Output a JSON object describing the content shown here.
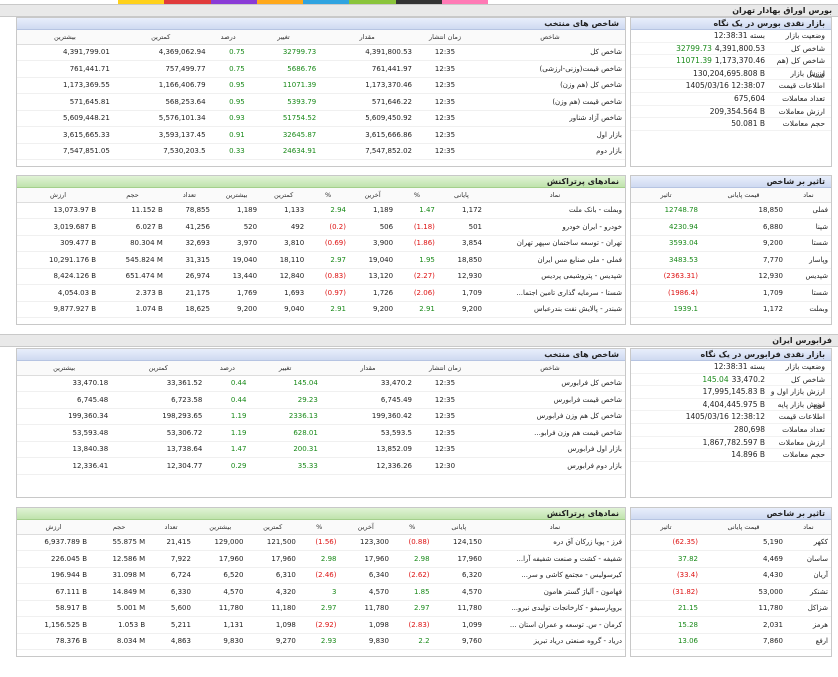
{
  "colorstrip": [
    "#ffd11a",
    "#e03b3b",
    "#8a3bd6",
    "#ffa81a",
    "#2fa3e0",
    "#8ac43b",
    "#333333",
    "#ff7ab5"
  ],
  "tehran": {
    "title": "بورس اوراق بهادار تهران",
    "overview": {
      "title": "بازار نقدی بورس در یک نگاه",
      "rows": [
        {
          "label": "وضعیت بازار",
          "value": "بسته 12:38:31",
          "change": ""
        },
        {
          "label": "شاخص کل",
          "value": "4,391,800.53",
          "change": "32799.73"
        },
        {
          "label": "شاخص کل (هم وزن)",
          "value": "1,173,370.46",
          "change": "11071.39"
        },
        {
          "label": "ارزش بازار",
          "value": "130,204,695.808 B",
          "change": ""
        },
        {
          "label": "اطلاعات قیمت",
          "value": "1405/03/16 12:38:07",
          "change": ""
        },
        {
          "label": "تعداد معاملات",
          "value": "675,604",
          "change": ""
        },
        {
          "label": "ارزش معاملات",
          "value": "209,354.564 B",
          "change": ""
        },
        {
          "label": "حجم معاملات",
          "value": "50.081 B",
          "change": ""
        }
      ]
    },
    "indices": {
      "title": "شاخص های منتخب",
      "headers": [
        "شاخص",
        "زمان انتشار",
        "مقدار",
        "تغییر",
        "درصد",
        "کمترین",
        "بیشترین"
      ],
      "rows": [
        [
          "شاخص کل",
          "12:35",
          "4,391,800.53",
          "32799.73",
          "0.75",
          "4,369,062.94",
          "4,391,799.01"
        ],
        [
          "شاخص قیمت(وزنی-ارزشی)",
          "12:35",
          "761,441.97",
          "5686.76",
          "0.75",
          "757,499.77",
          "761,441.71"
        ],
        [
          "شاخص کل (هم وزن)",
          "12:35",
          "1,173,370.46",
          "11071.39",
          "0.95",
          "1,166,406.79",
          "1,173,369.55"
        ],
        [
          "شاخص قیمت (هم وزن)",
          "12:35",
          "571,646.22",
          "5393.79",
          "0.95",
          "568,253.64",
          "571,645.81"
        ],
        [
          "شاخص آزاد شناور",
          "12:35",
          "5,609,450.92",
          "51754.52",
          "0.93",
          "5,576,101.34",
          "5,609,448.21"
        ],
        [
          "بازار اول",
          "12:35",
          "3,615,666.86",
          "32645.87",
          "0.91",
          "3,593,137.45",
          "3,615,665.33"
        ],
        [
          "بازار دوم",
          "12:35",
          "7,547,852.02",
          "24634.91",
          "0.33",
          "7,530,203.5",
          "7,547,851.05"
        ]
      ]
    },
    "impact": {
      "title": "تاثیر بر شاخص",
      "headers": [
        "نماد",
        "قیمت پایانی",
        "تاثیر"
      ],
      "rows": [
        [
          "فملی",
          "18,850",
          "12748.78"
        ],
        [
          "شپنا",
          "6,880",
          "4230.94"
        ],
        [
          "شستا",
          "9,200",
          "3593.04"
        ],
        [
          "وپاسار",
          "7,770",
          "3483.53"
        ],
        [
          "شپدیس",
          "12,930",
          "(2363.31)"
        ],
        [
          "شستا",
          "1,709",
          "(1986.4)"
        ],
        [
          "وبملت",
          "1,172",
          "1939.1"
        ]
      ]
    },
    "active": {
      "title": "نمادهای پرتراکنش",
      "headers": [
        "نماد",
        "پایانی",
        "%",
        "آخرین",
        "%",
        "کمترین",
        "بیشترین",
        "تعداد",
        "حجم",
        "ارزش"
      ],
      "rows": [
        [
          "وبملت - بانک ملت",
          "1,172",
          "1.47",
          "1,189",
          "2.94",
          "1,133",
          "1,189",
          "78,855",
          "11.152 B",
          "13,073.97 B"
        ],
        [
          "خودرو - ایران خودرو",
          "501",
          "(1.18)",
          "506",
          "(0.2)",
          "492",
          "520",
          "41,256",
          "6.027 B",
          "3,019.687 B"
        ],
        [
          "تهران - توسعه ساختمان سپهر تهران",
          "3,854",
          "(1.86)",
          "3,900",
          "(0.69)",
          "3,810",
          "3,970",
          "32,693",
          "80.304 M",
          "309.477 B"
        ],
        [
          "فملی - ملی صنایع مس ایران",
          "18,850",
          "1.95",
          "19,040",
          "2.97",
          "18,110",
          "19,040",
          "31,315",
          "545.824 M",
          "10,291.176 B"
        ],
        [
          "شپدیس - پتروشیمی پردیس",
          "12,930",
          "(2.27)",
          "13,120",
          "(0.83)",
          "12,840",
          "13,440",
          "26,974",
          "651.474 M",
          "8,424.126 B"
        ],
        [
          "شستا - سرمایه گذاری تامین اجتما...",
          "1,709",
          "(2.06)",
          "1,726",
          "(0.97)",
          "1,693",
          "1,769",
          "21,175",
          "2.373 B",
          "4,054.03 B"
        ],
        [
          "شبندر - پالایش نفت بندرعباس",
          "9,200",
          "2.91",
          "9,200",
          "2.91",
          "9,040",
          "9,200",
          "18,625",
          "1.074 B",
          "9,877.927 B"
        ]
      ]
    }
  },
  "farabourse": {
    "title": "فرابورس ایران",
    "overview": {
      "title": "بازار نقدی فرابورس در یک نگاه",
      "rows": [
        {
          "label": "وضعیت بازار",
          "value": "بسته 12:38:31",
          "change": ""
        },
        {
          "label": "شاخص کل",
          "value": "33,470.2",
          "change": "145.04"
        },
        {
          "label": "ارزش بازار اول و دوم",
          "value": "17,995,145.83 B",
          "change": ""
        },
        {
          "label": "ارزش بازار پایه",
          "value": "4,404,445.975 B",
          "change": ""
        },
        {
          "label": "اطلاعات قیمت",
          "value": "1405/03/16 12:38:12",
          "change": ""
        },
        {
          "label": "تعداد معاملات",
          "value": "280,698",
          "change": ""
        },
        {
          "label": "ارزش معاملات",
          "value": "1,867,782.597 B",
          "change": ""
        },
        {
          "label": "حجم معاملات",
          "value": "14.896 B",
          "change": ""
        }
      ]
    },
    "indices": {
      "title": "شاخص های منتخب",
      "headers": [
        "شاخص",
        "زمان انتشار",
        "مقدار",
        "تغییر",
        "درصد",
        "کمترین",
        "بیشترین"
      ],
      "rows": [
        [
          "شاخص کل فرابورس",
          "12:35",
          "33,470.2",
          "145.04",
          "0.44",
          "33,361.52",
          "33,470.18"
        ],
        [
          "شاخص قیمت فرابورس",
          "12:35",
          "6,745.49",
          "29.23",
          "0.44",
          "6,723.58",
          "6,745.48"
        ],
        [
          "شاخص کل هم وزن فرابورس",
          "12:35",
          "199,360.42",
          "2336.13",
          "1.19",
          "198,293.65",
          "199,360.34"
        ],
        [
          "شاخص قیمت هم وزن فرابو...",
          "12:35",
          "53,593.5",
          "628.01",
          "1.19",
          "53,306.72",
          "53,593.48"
        ],
        [
          "بازار اول فرابورس",
          "12:35",
          "13,852.09",
          "200.31",
          "1.47",
          "13,738.64",
          "13,840.38"
        ],
        [
          "بازار دوم فرابورس",
          "12:30",
          "12,336.26",
          "35.33",
          "0.29",
          "12,304.77",
          "12,336.41"
        ]
      ]
    },
    "impact": {
      "title": "تاثیر بر شاخص",
      "headers": [
        "نماد",
        "قیمت پایانی",
        "تاثیر"
      ],
      "rows": [
        [
          "ککهر",
          "5,190",
          "(62.35)"
        ],
        [
          "ساسان",
          "4,469",
          "37.82"
        ],
        [
          "آریان",
          "4,430",
          "(33.4)"
        ],
        [
          "تشنکر",
          "53,000",
          "(31.82)"
        ],
        [
          "شزاکل",
          "11,780",
          "21.15"
        ],
        [
          "هرمز",
          "2,031",
          "15.28"
        ],
        [
          "ارفع",
          "7,860",
          "13.06"
        ]
      ]
    },
    "active": {
      "title": "نمادهای پرتراکنش",
      "headers": [
        "نماد",
        "پایانی",
        "%",
        "آخرین",
        "%",
        "کمترین",
        "بیشترین",
        "تعداد",
        "حجم",
        "ارزش"
      ],
      "rows": [
        [
          "فرز - پویا زرکان آق دره",
          "124,150",
          "(0.88)",
          "123,300",
          "(1.56)",
          "121,500",
          "129,000",
          "21,415",
          "55.875 M",
          "6,937.789 B"
        ],
        [
          "شفیفه - کشت و صنعت شفیفه آرا...",
          "17,960",
          "2.98",
          "17,960",
          "2.98",
          "17,960",
          "17,960",
          "7,922",
          "12.586 M",
          "226.045 B"
        ],
        [
          "کیرسولیس - مجتمع کاشی و سر...",
          "6,320",
          "(2.62)",
          "6,340",
          "(2.46)",
          "6,310",
          "6,520",
          "6,724",
          "31.098 M",
          "196.944 B"
        ],
        [
          "فهامون - آلیاژ گستر هامون",
          "4,570",
          "1.85",
          "4,570",
          "3",
          "4,320",
          "4,570",
          "6,330",
          "14.849 M",
          "67.111 B"
        ],
        [
          "بروپارسیفو - کارخانجات تولیدی نیرو...",
          "11,780",
          "2.97",
          "11,780",
          "2.97",
          "11,180",
          "11,780",
          "5,600",
          "5.001 M",
          "58.917 B"
        ],
        [
          "کرمان - س. توسعه و عمران استان ...",
          "1,099",
          "(2.83)",
          "1,098",
          "(2.92)",
          "1,098",
          "1,131",
          "5,211",
          "1.053 B",
          "1,156.525 B"
        ],
        [
          "دریاد - گروه صنعتی دریاد تبریز",
          "9,760",
          "2.2",
          "9,830",
          "2.93",
          "9,270",
          "9,830",
          "4,863",
          "8.034 M",
          "78.376 B"
        ]
      ]
    }
  }
}
